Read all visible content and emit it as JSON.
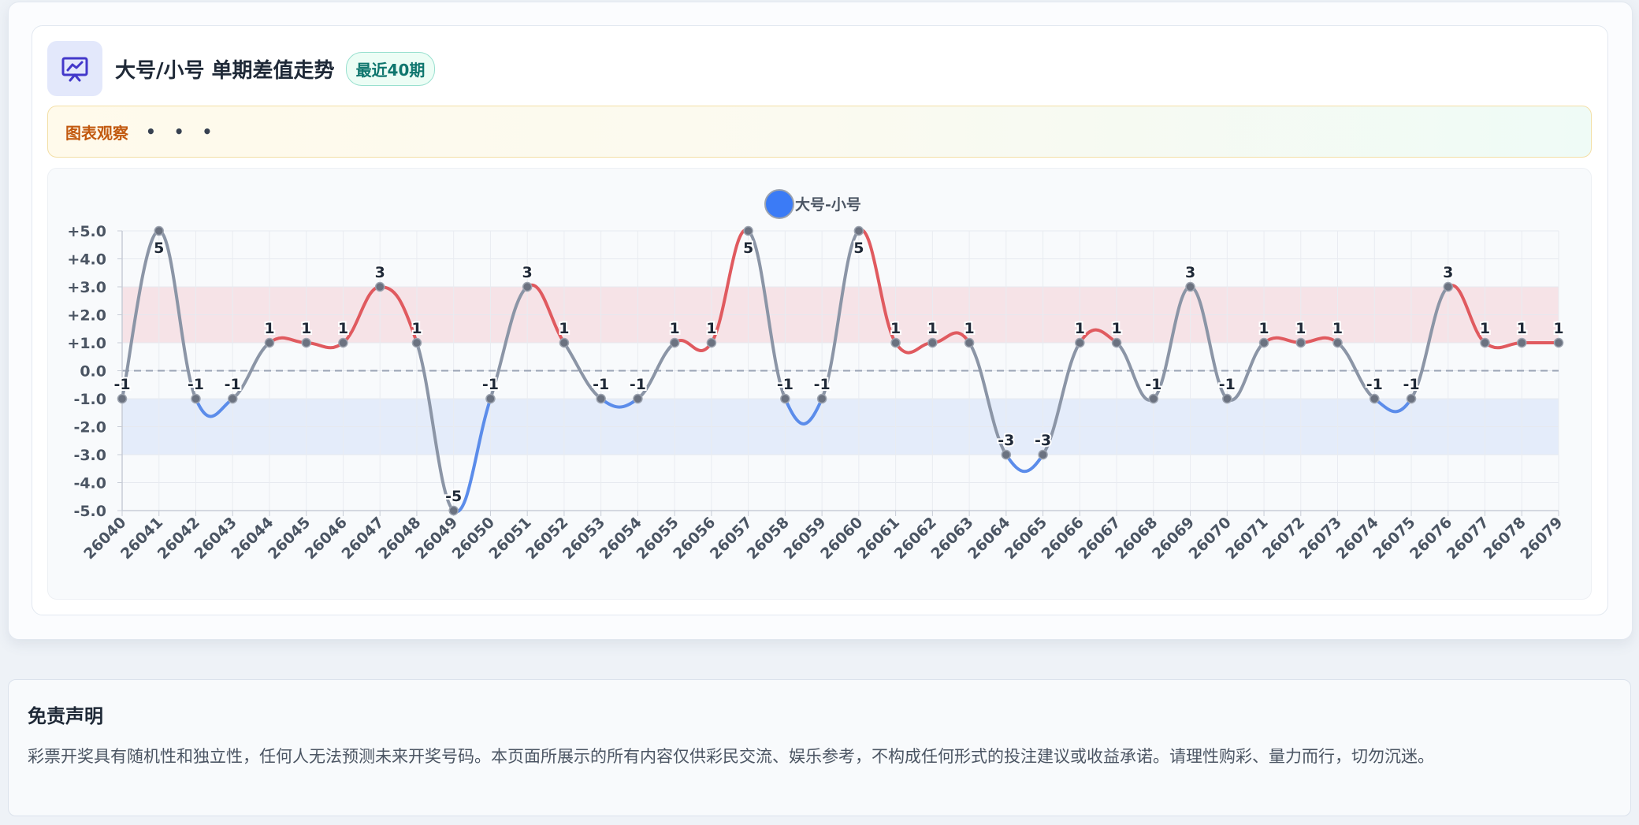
{
  "header": {
    "title": "大号/小号 单期差值走势",
    "badge": "最近40期",
    "icon": "presentation-chart-icon"
  },
  "observation": {
    "label": "图表观察",
    "dots": "• • •"
  },
  "chart_data": {
    "type": "line",
    "categories": [
      "26040",
      "26041",
      "26042",
      "26043",
      "26044",
      "26045",
      "26046",
      "26047",
      "26048",
      "26049",
      "26050",
      "26051",
      "26052",
      "26053",
      "26054",
      "26055",
      "26056",
      "26057",
      "26058",
      "26059",
      "26060",
      "26061",
      "26062",
      "26063",
      "26064",
      "26065",
      "26066",
      "26067",
      "26068",
      "26069",
      "26070",
      "26071",
      "26072",
      "26073",
      "26074",
      "26075",
      "26076",
      "26077",
      "26078",
      "26079"
    ],
    "series": [
      {
        "name": "大号-小号",
        "values": [
          -1,
          5,
          -1,
          -1,
          1,
          1,
          1,
          3,
          1,
          -5,
          -1,
          3,
          1,
          -1,
          -1,
          1,
          1,
          5,
          -1,
          -1,
          5,
          1,
          1,
          1,
          -3,
          -3,
          1,
          1,
          -1,
          3,
          -1,
          1,
          1,
          1,
          -1,
          -1,
          3,
          1,
          1,
          1
        ]
      }
    ],
    "ylim": [
      -5,
      5
    ],
    "yticks": [
      "+5.0",
      "+4.0",
      "+3.0",
      "+2.0",
      "+1.0",
      "0.0",
      "-1.0",
      "-2.0",
      "-3.0",
      "-4.0",
      "-5.0"
    ],
    "bands": [
      {
        "from": 1,
        "to": 3,
        "color": "#f6e3e7"
      },
      {
        "from": -3,
        "to": -1,
        "color": "#e4ecfa"
      }
    ],
    "zero_line": "dashed",
    "grid": true,
    "legend_position": "top-center",
    "colors": {
      "positive": "#e05a5f",
      "negative": "#5b8cea",
      "neutral": "#8b95a6",
      "legend_marker": "#3b7bf6",
      "point": "#6b7280"
    }
  },
  "disclaimer": {
    "title": "免责声明",
    "text": "彩票开奖具有随机性和独立性，任何人无法预测未来开奖号码。本页面所展示的所有内容仅供彩民交流、娱乐参考，不构成任何形式的投注建议或收益承诺。请理性购彩、量力而行，切勿沉迷。"
  }
}
